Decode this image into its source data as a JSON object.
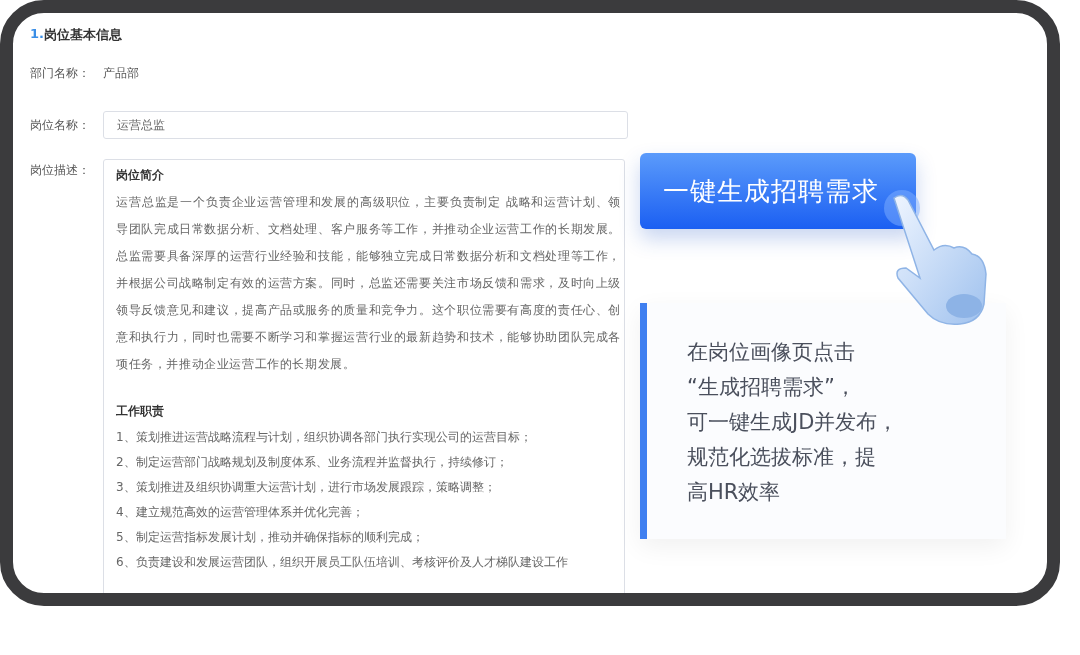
{
  "section": {
    "number": "1.",
    "title": "岗位基本信息"
  },
  "fields": [
    {
      "kind": "text",
      "label": "部门名称：",
      "value": "产品部"
    },
    {
      "kind": "input",
      "label": "岗位名称：",
      "value": "运营总监"
    },
    {
      "kind": "document",
      "label": "岗位描述：",
      "blocks": [
        {
          "kind": "paragraph",
          "heading": "岗位简介",
          "text": "运营总监是一个负责企业运营管理和发展的高级职位，主要负责制定 战略和运营计划、领导团队完成日常数据分析、文档处理、客户服务等工作，并推动企业运营工作的长期发展。总监需要具备深厚的运营行业经验和技能，能够独立完成日常数据分析和文档处理等工作，并根据公司战略制定有效的运营方案。同时，总监还需要关注市场反馈和需求，及时向上级领导反馈意见和建议，提高产品或服务的质量和竞争力。这个职位需要有高度的责任心、创意和执行力，同时也需要不断学习和掌握运营行业的最新趋势和技术，能够协助团队完成各项任务，并推动企业运营工作的长期发展。"
        },
        {
          "kind": "list",
          "heading": "工作职责",
          "items": [
            "1、策划推进运营战略流程与计划，组织协调各部门执行实现公司的运营目标；",
            "2、制定运营部门战略规划及制度体系、业务流程并监督执行，持续修订；",
            "3、策划推进及组织协调重大运营计划，进行市场发展跟踪，策略调整；",
            "4、建立规范高效的运营管理体系并优化完善；",
            "5、制定运营指标发展计划，推动并确保指标的顺利完成；",
            "6、负责建设和发展运营团队，组织开展员工队伍培训、考核评价及人才梯队建设工作"
          ]
        }
      ]
    }
  ],
  "callout": {
    "button": "一键生成招聘需求",
    "note": [
      "在岗位画像页点击",
      "“生成招聘需求”，",
      "可一键生成JD并发布，",
      "规范化选拔标准，提",
      "高HR效率"
    ]
  }
}
